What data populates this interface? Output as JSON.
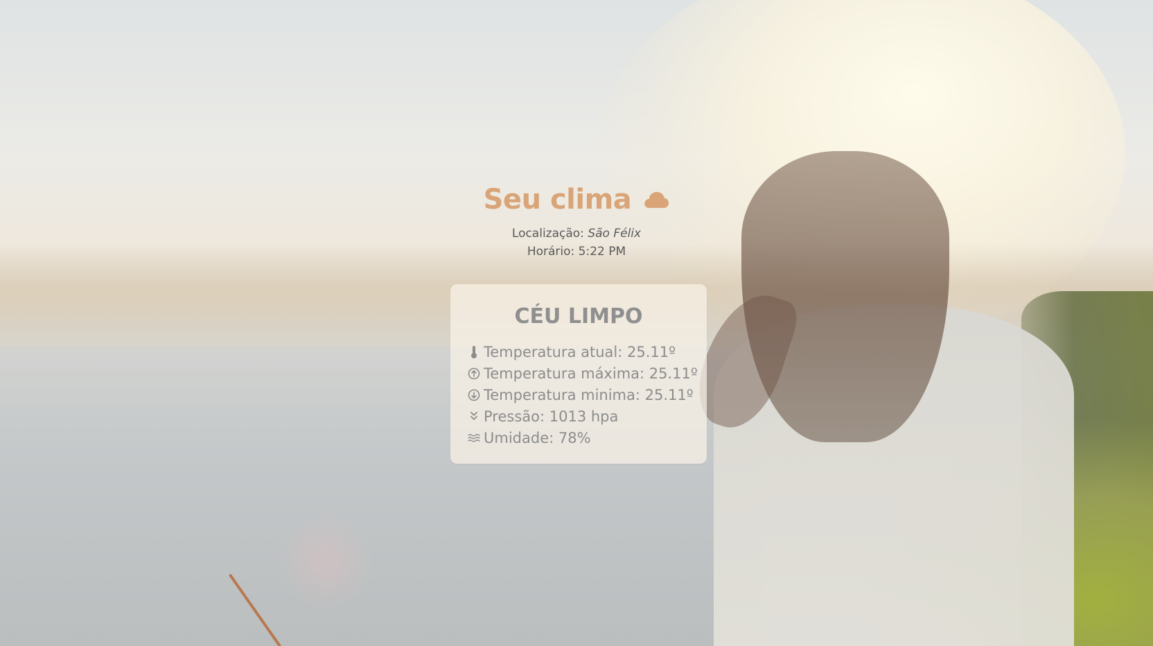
{
  "header": {
    "title": "Seu clima",
    "title_icon": "cloud-icon",
    "location_label": "Localização:",
    "location_value": "São Félix",
    "time_label": "Horário:",
    "time_value": "5:22 PM"
  },
  "weather_card": {
    "condition": "CÉU LIMPO",
    "rows": [
      {
        "icon": "thermometer-icon",
        "text": "Temperatura atual: 25.11º"
      },
      {
        "icon": "arrow-up-circle-icon",
        "text": "Temperatura máxima: 25.11º"
      },
      {
        "icon": "arrow-down-circle-icon",
        "text": "Temperatura minima: 25.11º"
      },
      {
        "icon": "double-chevron-down-icon",
        "text": "Pressão: 1013 hpa"
      },
      {
        "icon": "waves-icon",
        "text": "Umidade: 78%"
      }
    ]
  },
  "colors": {
    "title_accent": "#d9a477",
    "card_text": "#8c8c8c",
    "meta_text": "#5a5a5a"
  }
}
